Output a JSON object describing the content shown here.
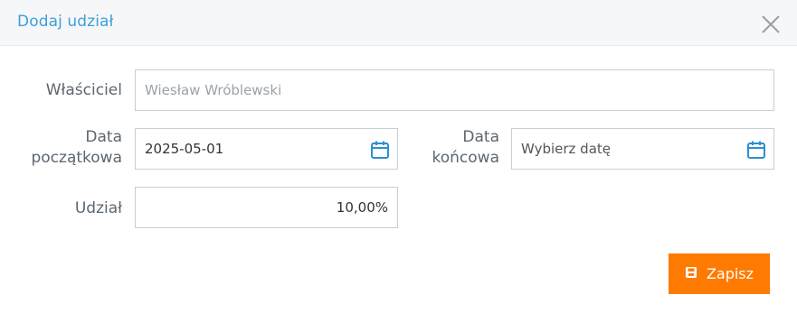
{
  "dialog": {
    "title": "Dodaj udział",
    "close_icon": "close-icon"
  },
  "form": {
    "owner": {
      "label": "Właściciel",
      "value": "Wiesław Wróblewski"
    },
    "start_date": {
      "label_line1": "Data",
      "label_line2": "początkowa",
      "value": "2025-05-01",
      "icon": "calendar-icon"
    },
    "end_date": {
      "label_line1": "Data",
      "label_line2": "końcowa",
      "placeholder": "Wybierz datę",
      "icon": "calendar-icon"
    },
    "share": {
      "label": "Udział",
      "value": "10,00%"
    }
  },
  "actions": {
    "save_label": "Zapisz",
    "save_icon": "save-icon",
    "accent": "#ff7a00"
  },
  "colors": {
    "title": "#3d9fd9",
    "calendar_icon": "#2a8fd0"
  }
}
